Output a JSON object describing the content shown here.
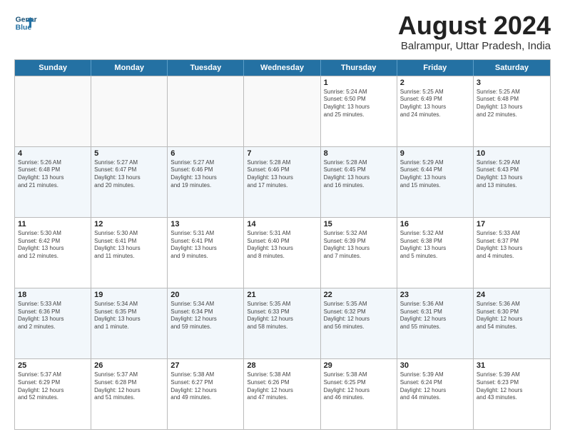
{
  "logo": {
    "line1": "General",
    "line2": "Blue"
  },
  "title": "August 2024",
  "subtitle": "Balrampur, Uttar Pradesh, India",
  "weekdays": [
    "Sunday",
    "Monday",
    "Tuesday",
    "Wednesday",
    "Thursday",
    "Friday",
    "Saturday"
  ],
  "rows": [
    {
      "alt": false,
      "cells": [
        {
          "day": "",
          "detail": ""
        },
        {
          "day": "",
          "detail": ""
        },
        {
          "day": "",
          "detail": ""
        },
        {
          "day": "",
          "detail": ""
        },
        {
          "day": "1",
          "detail": "Sunrise: 5:24 AM\nSunset: 6:50 PM\nDaylight: 13 hours\nand 25 minutes."
        },
        {
          "day": "2",
          "detail": "Sunrise: 5:25 AM\nSunset: 6:49 PM\nDaylight: 13 hours\nand 24 minutes."
        },
        {
          "day": "3",
          "detail": "Sunrise: 5:25 AM\nSunset: 6:48 PM\nDaylight: 13 hours\nand 22 minutes."
        }
      ]
    },
    {
      "alt": true,
      "cells": [
        {
          "day": "4",
          "detail": "Sunrise: 5:26 AM\nSunset: 6:48 PM\nDaylight: 13 hours\nand 21 minutes."
        },
        {
          "day": "5",
          "detail": "Sunrise: 5:27 AM\nSunset: 6:47 PM\nDaylight: 13 hours\nand 20 minutes."
        },
        {
          "day": "6",
          "detail": "Sunrise: 5:27 AM\nSunset: 6:46 PM\nDaylight: 13 hours\nand 19 minutes."
        },
        {
          "day": "7",
          "detail": "Sunrise: 5:28 AM\nSunset: 6:46 PM\nDaylight: 13 hours\nand 17 minutes."
        },
        {
          "day": "8",
          "detail": "Sunrise: 5:28 AM\nSunset: 6:45 PM\nDaylight: 13 hours\nand 16 minutes."
        },
        {
          "day": "9",
          "detail": "Sunrise: 5:29 AM\nSunset: 6:44 PM\nDaylight: 13 hours\nand 15 minutes."
        },
        {
          "day": "10",
          "detail": "Sunrise: 5:29 AM\nSunset: 6:43 PM\nDaylight: 13 hours\nand 13 minutes."
        }
      ]
    },
    {
      "alt": false,
      "cells": [
        {
          "day": "11",
          "detail": "Sunrise: 5:30 AM\nSunset: 6:42 PM\nDaylight: 13 hours\nand 12 minutes."
        },
        {
          "day": "12",
          "detail": "Sunrise: 5:30 AM\nSunset: 6:41 PM\nDaylight: 13 hours\nand 11 minutes."
        },
        {
          "day": "13",
          "detail": "Sunrise: 5:31 AM\nSunset: 6:41 PM\nDaylight: 13 hours\nand 9 minutes."
        },
        {
          "day": "14",
          "detail": "Sunrise: 5:31 AM\nSunset: 6:40 PM\nDaylight: 13 hours\nand 8 minutes."
        },
        {
          "day": "15",
          "detail": "Sunrise: 5:32 AM\nSunset: 6:39 PM\nDaylight: 13 hours\nand 7 minutes."
        },
        {
          "day": "16",
          "detail": "Sunrise: 5:32 AM\nSunset: 6:38 PM\nDaylight: 13 hours\nand 5 minutes."
        },
        {
          "day": "17",
          "detail": "Sunrise: 5:33 AM\nSunset: 6:37 PM\nDaylight: 13 hours\nand 4 minutes."
        }
      ]
    },
    {
      "alt": true,
      "cells": [
        {
          "day": "18",
          "detail": "Sunrise: 5:33 AM\nSunset: 6:36 PM\nDaylight: 13 hours\nand 2 minutes."
        },
        {
          "day": "19",
          "detail": "Sunrise: 5:34 AM\nSunset: 6:35 PM\nDaylight: 13 hours\nand 1 minute."
        },
        {
          "day": "20",
          "detail": "Sunrise: 5:34 AM\nSunset: 6:34 PM\nDaylight: 12 hours\nand 59 minutes."
        },
        {
          "day": "21",
          "detail": "Sunrise: 5:35 AM\nSunset: 6:33 PM\nDaylight: 12 hours\nand 58 minutes."
        },
        {
          "day": "22",
          "detail": "Sunrise: 5:35 AM\nSunset: 6:32 PM\nDaylight: 12 hours\nand 56 minutes."
        },
        {
          "day": "23",
          "detail": "Sunrise: 5:36 AM\nSunset: 6:31 PM\nDaylight: 12 hours\nand 55 minutes."
        },
        {
          "day": "24",
          "detail": "Sunrise: 5:36 AM\nSunset: 6:30 PM\nDaylight: 12 hours\nand 54 minutes."
        }
      ]
    },
    {
      "alt": false,
      "cells": [
        {
          "day": "25",
          "detail": "Sunrise: 5:37 AM\nSunset: 6:29 PM\nDaylight: 12 hours\nand 52 minutes."
        },
        {
          "day": "26",
          "detail": "Sunrise: 5:37 AM\nSunset: 6:28 PM\nDaylight: 12 hours\nand 51 minutes."
        },
        {
          "day": "27",
          "detail": "Sunrise: 5:38 AM\nSunset: 6:27 PM\nDaylight: 12 hours\nand 49 minutes."
        },
        {
          "day": "28",
          "detail": "Sunrise: 5:38 AM\nSunset: 6:26 PM\nDaylight: 12 hours\nand 47 minutes."
        },
        {
          "day": "29",
          "detail": "Sunrise: 5:38 AM\nSunset: 6:25 PM\nDaylight: 12 hours\nand 46 minutes."
        },
        {
          "day": "30",
          "detail": "Sunrise: 5:39 AM\nSunset: 6:24 PM\nDaylight: 12 hours\nand 44 minutes."
        },
        {
          "day": "31",
          "detail": "Sunrise: 5:39 AM\nSunset: 6:23 PM\nDaylight: 12 hours\nand 43 minutes."
        }
      ]
    }
  ]
}
